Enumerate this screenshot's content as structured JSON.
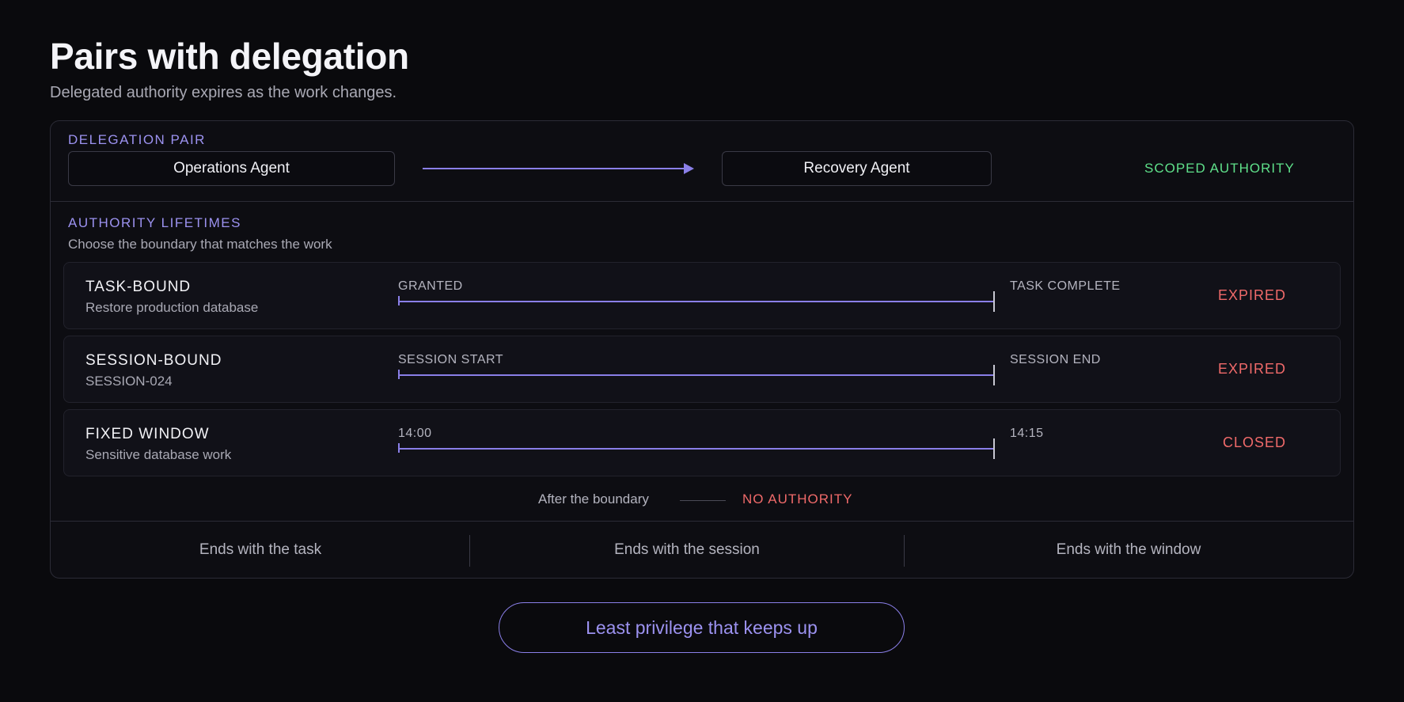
{
  "header": {
    "title": "Pairs with delegation",
    "subtitle": "Delegated authority expires as the work changes."
  },
  "pair": {
    "label": "DELEGATION PAIR",
    "from_agent": "Operations Agent",
    "to_agent": "Recovery Agent",
    "scope": "SCOPED AUTHORITY"
  },
  "lifetimes": {
    "label": "AUTHORITY LIFETIMES",
    "note": "Choose the boundary that matches the work",
    "rows": [
      {
        "name": "TASK-BOUND",
        "desc": "Restore production database",
        "start": "GRANTED",
        "end": "TASK COMPLETE",
        "status": "EXPIRED"
      },
      {
        "name": "SESSION-BOUND",
        "desc": "SESSION-024",
        "start": "SESSION START",
        "end": "SESSION END",
        "status": "EXPIRED"
      },
      {
        "name": "FIXED WINDOW",
        "desc": "Sensitive database work",
        "start": "14:00",
        "end": "14:15",
        "status": "CLOSED"
      }
    ],
    "after_text": "After the boundary",
    "after_status": "NO AUTHORITY"
  },
  "footer": {
    "cells": [
      "Ends with the task",
      "Ends with the session",
      "Ends with the window"
    ]
  },
  "cta": {
    "label": "Least privilege that keeps up"
  },
  "colors": {
    "accent": "#8a7fe8",
    "scope_green": "#5fe08a",
    "status_red": "#f06a6a",
    "background": "#0a0a0d"
  }
}
